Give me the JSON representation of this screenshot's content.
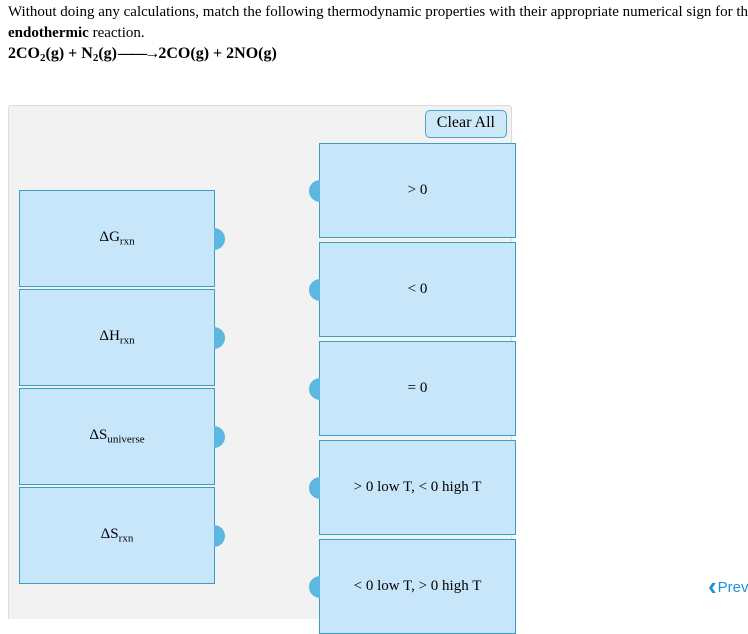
{
  "question": {
    "line1_part1": "Without doing any calculations, match the following thermodynamic properties with their appropriate numerical sign for th",
    "line2_bold": "endothermic",
    "line2_rest": " reaction.",
    "reaction": {
      "full": "2CO2(g) + N2(g)⟶2CO(g) + 2NO(g)",
      "r1_pre": "2CO",
      "r1_sub": "2",
      "r1_post": "(g) + N",
      "r2_sub": "2",
      "r2_post": "(g)",
      "arrow": "——→",
      "products": "2CO(g) + 2NO(g)"
    }
  },
  "panel": {
    "clear_all_label": "Clear All",
    "prompts": [
      {
        "id": "delta-g-rxn",
        "symbol": "ΔG",
        "sub": "rxn",
        "text": "ΔGrxn"
      },
      {
        "id": "delta-h-rxn",
        "symbol": "ΔH",
        "sub": "rxn",
        "text": "ΔHrxn"
      },
      {
        "id": "delta-s-universe",
        "symbol": "ΔS",
        "sub": "universe",
        "text": "ΔSuniverse"
      },
      {
        "id": "delta-s-rxn",
        "symbol": "ΔS",
        "sub": "rxn",
        "text": "ΔSrxn"
      }
    ],
    "answers": [
      {
        "id": "greater-than-zero",
        "label": "> 0"
      },
      {
        "id": "less-than-zero",
        "label": "< 0"
      },
      {
        "id": "equal-zero",
        "label": "= 0"
      },
      {
        "id": "pos-low-neg-high",
        "label": "> 0 low T, < 0 high T"
      },
      {
        "id": "neg-low-pos-high",
        "label": "< 0 low T, > 0 high T"
      }
    ]
  },
  "navigation": {
    "prev_label": "Prev",
    "prev_chevron": "‹"
  },
  "colors": {
    "tile_fill": "#c8e6fa",
    "tile_border": "#3c9dc4",
    "nub": "#5cb8e0",
    "panel_bg": "#f2f2f2",
    "button_fill": "#cde9f7",
    "button_border": "#4aa3cc",
    "nav_blue": "#1f8fd6"
  }
}
